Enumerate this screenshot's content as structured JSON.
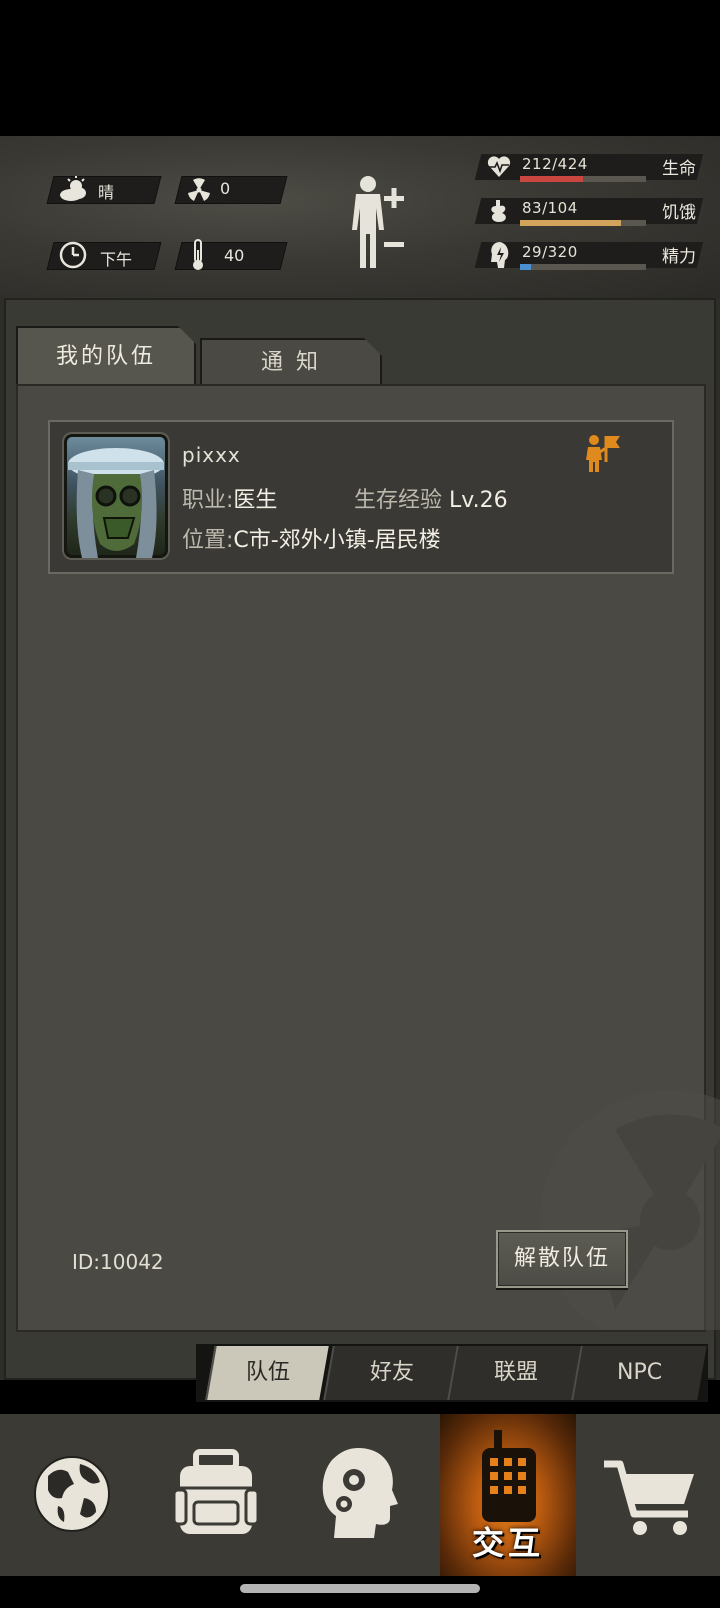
{
  "hud": {
    "weather": {
      "icon": "cloud-sun-icon",
      "value": "晴"
    },
    "radiation": {
      "icon": "radiation-icon",
      "value": "0"
    },
    "time": {
      "icon": "clock-icon",
      "value": "下午"
    },
    "temperature": {
      "icon": "thermometer-icon",
      "value": "40"
    },
    "body_icon": "body-status-icon",
    "stats": [
      {
        "icon": "heart-icon",
        "value": "212/424",
        "label": "生命",
        "fill": 0.5,
        "color": "#c9473f"
      },
      {
        "icon": "stomach-icon",
        "value": "83/104",
        "label": "饥饿",
        "fill": 0.8,
        "color": "#d2a35a"
      },
      {
        "icon": "energy-icon",
        "value": "29/320",
        "label": "精力",
        "fill": 0.09,
        "color": "#4a8fd0"
      }
    ]
  },
  "tabs": [
    "我的队伍",
    "通 知"
  ],
  "member": {
    "name": "pixxx",
    "job_label": "职业:",
    "job": "医生",
    "exp_label": "生存经验",
    "level": "Lv.26",
    "location_label": "位置:",
    "location": "C市-郊外小镇-居民楼",
    "leader_icon": "leader-flag-icon"
  },
  "team_id": "ID:10042",
  "disband_label": "解散队伍",
  "subtabs": [
    "队伍",
    "好友",
    "联盟",
    "NPC"
  ],
  "nav": {
    "items": [
      "globe-icon",
      "backpack-icon",
      "brain-skills-icon",
      "radio-icon",
      "cart-icon"
    ],
    "active_label": "交互"
  }
}
